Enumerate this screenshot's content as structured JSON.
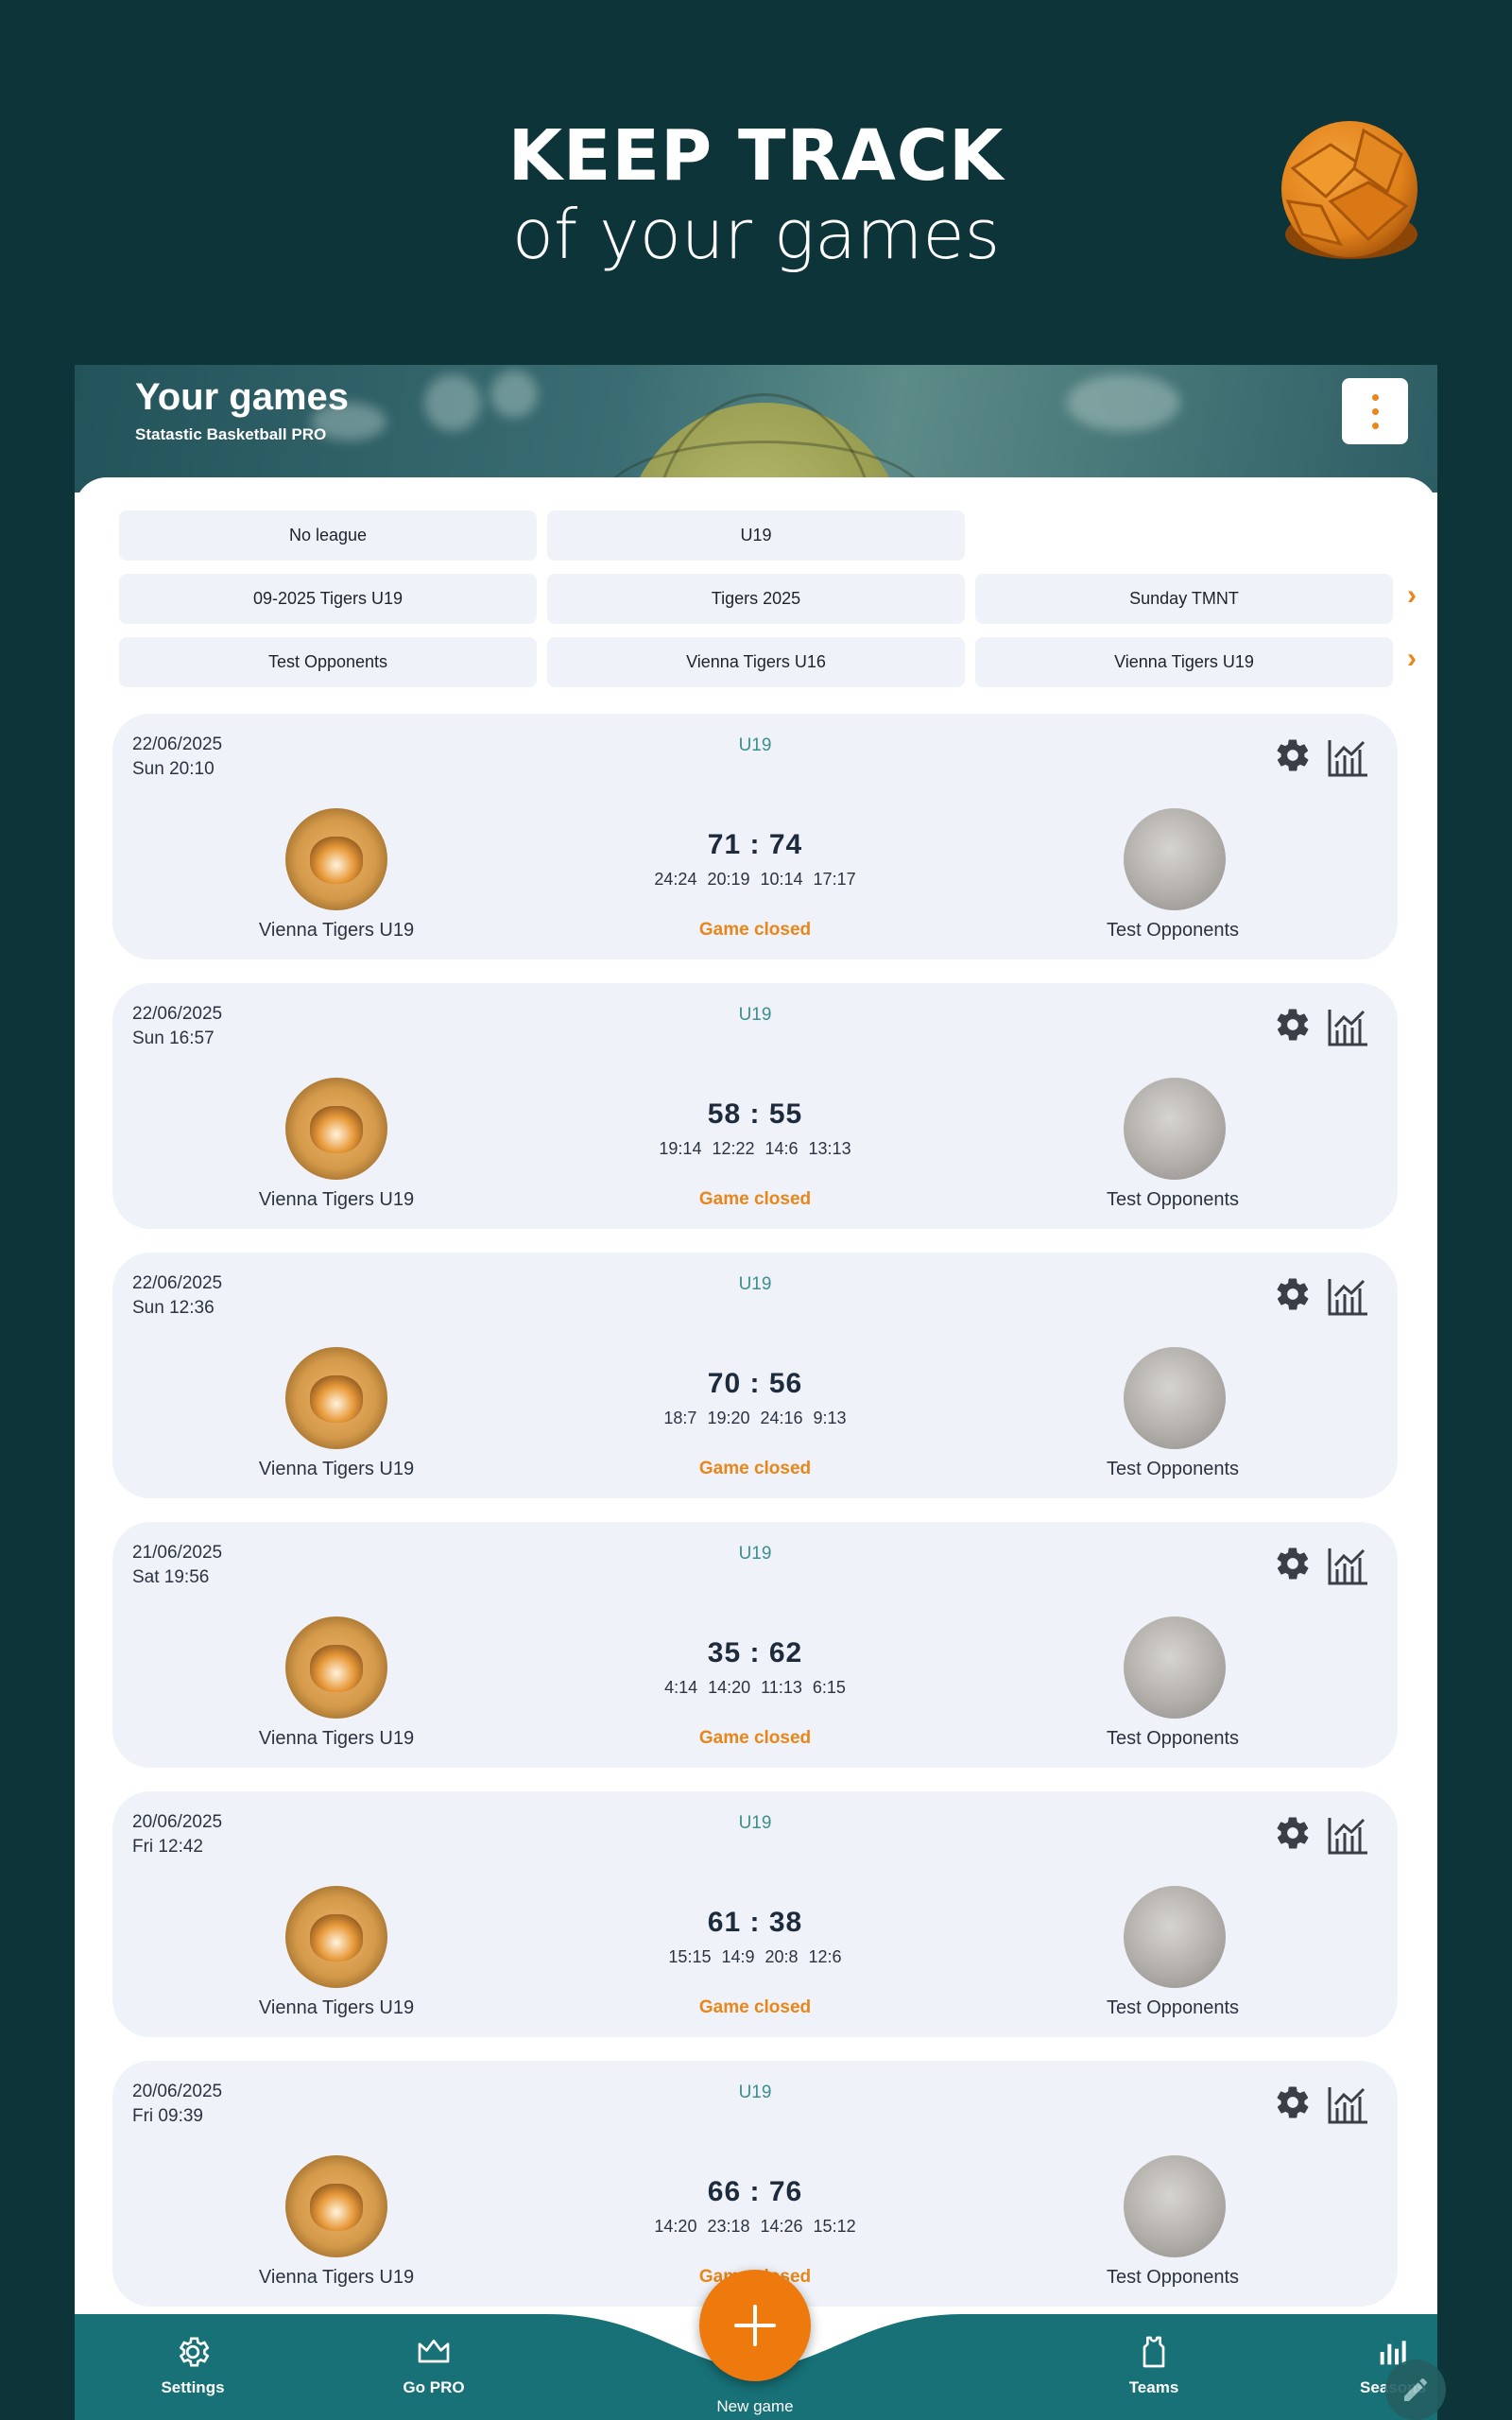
{
  "promo": {
    "title": "KEEP TRACK",
    "subtitle": "of your games"
  },
  "header": {
    "title": "Your games",
    "subtitle": "Statastic Basketball PRO"
  },
  "filters": {
    "row1": [
      "No league",
      "U19"
    ],
    "row2": [
      "09-2025 Tigers U19",
      "Tigers 2025",
      "Sunday TMNT"
    ],
    "row3": [
      "Test Opponents",
      "Vienna Tigers U16",
      "Vienna Tigers U19"
    ],
    "arrow": "›"
  },
  "games": [
    {
      "date": "22/06/2025",
      "time": "Sun 20:10",
      "league": "U19",
      "home": "Vienna Tigers U19",
      "away": "Test Opponents",
      "score": "71 : 74",
      "quarters": "24:24 20:19 10:14 17:17",
      "status": "Game closed"
    },
    {
      "date": "22/06/2025",
      "time": "Sun 16:57",
      "league": "U19",
      "home": "Vienna Tigers U19",
      "away": "Test Opponents",
      "score": "58 : 55",
      "quarters": "19:14 12:22 14:6 13:13",
      "status": "Game closed"
    },
    {
      "date": "22/06/2025",
      "time": "Sun 12:36",
      "league": "U19",
      "home": "Vienna Tigers U19",
      "away": "Test Opponents",
      "score": "70 : 56",
      "quarters": "18:7 19:20 24:16 9:13",
      "status": "Game closed"
    },
    {
      "date": "21/06/2025",
      "time": "Sat 19:56",
      "league": "U19",
      "home": "Vienna Tigers U19",
      "away": "Test Opponents",
      "score": "35 : 62",
      "quarters": "4:14 14:20 11:13 6:15",
      "status": "Game closed"
    },
    {
      "date": "20/06/2025",
      "time": "Fri 12:42",
      "league": "U19",
      "home": "Vienna Tigers U19",
      "away": "Test Opponents",
      "score": "61 : 38",
      "quarters": "15:15 14:9 20:8 12:6",
      "status": "Game closed"
    },
    {
      "date": "20/06/2025",
      "time": "Fri 09:39",
      "league": "U19",
      "home": "Vienna Tigers U19",
      "away": "Test Opponents",
      "score": "66 : 76",
      "quarters": "14:20 23:18 14:26 15:12",
      "status": "Game closed"
    }
  ],
  "nav": {
    "settings": "Settings",
    "go_pro": "Go PRO",
    "new_game": "New game",
    "teams": "Teams",
    "seasons": "Seasons"
  },
  "colors": {
    "background": "#0d3439",
    "accent": "#ee7a0d",
    "nav": "#177176",
    "card": "#eff2f8",
    "league_text": "#3b8f8c"
  },
  "icons": {
    "menu": "more-vertical-icon",
    "settings": "gear-icon",
    "stats": "chart-icon",
    "go_pro": "crown-icon",
    "new_game": "plus-icon",
    "teams": "jersey-icon",
    "seasons": "bar-chart-icon",
    "edit": "pencil-icon"
  }
}
